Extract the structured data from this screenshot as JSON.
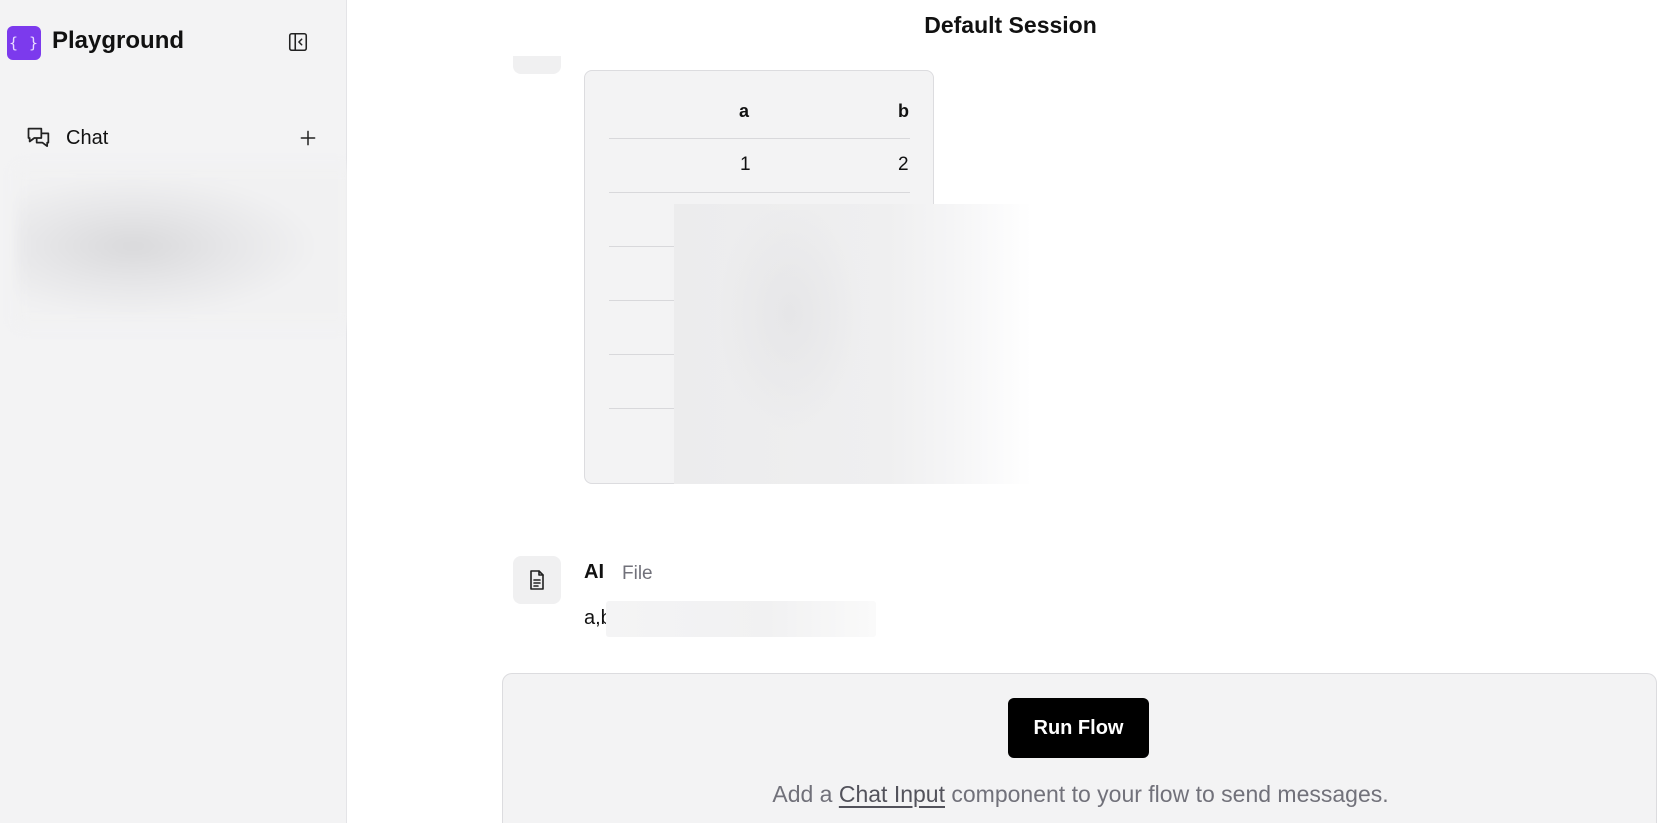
{
  "app": {
    "logo_glyph": "{ }",
    "title": "Playground"
  },
  "sidebar": {
    "collapse_icon": "panel-left-close-icon",
    "chat_label": "Chat",
    "chat_icon": "messages-square-icon",
    "add_icon": "plus-icon"
  },
  "session": {
    "title": "Default Session"
  },
  "table": {
    "columns": [
      "a",
      "b"
    ],
    "rows": [
      [
        "1",
        "2"
      ]
    ]
  },
  "ai_message": {
    "sender": "AI",
    "tag": "File",
    "text_visible": "a,b",
    "icon": "file-text-icon"
  },
  "input_area": {
    "run_button": "Run Flow",
    "hint_before": "Add a ",
    "hint_link": "Chat Input",
    "hint_after": " component to your flow to send messages."
  },
  "colors": {
    "logo_bg": "#7c3aed",
    "button_bg": "#000000",
    "muted_text": "#71717a"
  }
}
